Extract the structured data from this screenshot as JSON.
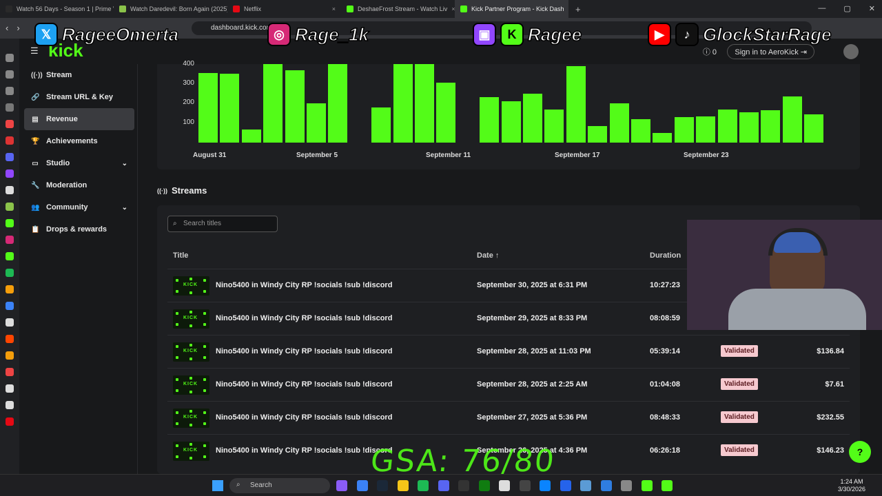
{
  "browser": {
    "tabs": [
      {
        "label": "Watch 56 Days - Season 1 | Prime Vi",
        "color": "#2a2a2a"
      },
      {
        "label": "Watch Daredevil: Born Again (2025) |",
        "color": "#8bc34a"
      },
      {
        "label": "Netflix",
        "color": "#e50914"
      },
      {
        "label": "DeshaeFrost Stream - Watch Liv",
        "color": "#53fc18"
      },
      {
        "label": "Kick Partner Program - Kick Dash",
        "color": "#53fc18"
      }
    ],
    "url": "dashboard.kick.com"
  },
  "overlay": {
    "x_handle": "RageeOmerta",
    "instagram_handle": "Rage_1k",
    "kick_handle": "Ragee",
    "youtube_handle": "GlockStarRage",
    "gsa_text": "GSA: 76/80"
  },
  "header": {
    "signin_label": "Sign in to AeroKick",
    "notif_count": "0"
  },
  "sidebar": {
    "items": [
      {
        "label": "Stream",
        "icon": "((·))"
      },
      {
        "label": "Stream URL & Key",
        "icon": "🔗"
      },
      {
        "label": "Revenue",
        "icon": "▤"
      },
      {
        "label": "Achievements",
        "icon": "🏆"
      },
      {
        "label": "Studio",
        "icon": "▭",
        "chevron": "⌄"
      },
      {
        "label": "Moderation",
        "icon": "🔧"
      },
      {
        "label": "Community",
        "icon": "👥",
        "chevron": "⌄"
      },
      {
        "label": "Drops & rewards",
        "icon": "📋"
      }
    ]
  },
  "chart_data": {
    "type": "bar",
    "y_ticks": [
      "400",
      "300",
      "200",
      "100"
    ],
    "x_ticks": [
      "August 31",
      "September 5",
      "September 11",
      "September 17",
      "September 23"
    ],
    "values": [
      355,
      350,
      65,
      405,
      370,
      200,
      405,
      0,
      180,
      405,
      405,
      305,
      0,
      230,
      210,
      250,
      170,
      390,
      85,
      200,
      120,
      50,
      130,
      135,
      170,
      155,
      165,
      235,
      145
    ],
    "ylim": [
      0,
      420
    ],
    "color": "#53fc18"
  },
  "streams": {
    "heading": "Streams",
    "search_placeholder": "Search titles",
    "columns": {
      "title": "Title",
      "date": "Date",
      "sort_arrow": "↑",
      "duration": "Duration"
    },
    "rows": [
      {
        "title": "Nino5400 in Windy City RP !socials !sub !discord",
        "date": "September 30, 2025 at 6:31 PM",
        "duration": "10:27:23",
        "status": "",
        "amount": ""
      },
      {
        "title": "Nino5400 in Windy City RP !socials !sub !discord",
        "date": "September 29, 2025 at 8:33 PM",
        "duration": "08:08:59",
        "status": "",
        "amount": ""
      },
      {
        "title": "Nino5400 in Windy City RP !socials !sub !discord",
        "date": "September 28, 2025 at 11:03 PM",
        "duration": "05:39:14",
        "status": "Validated",
        "amount": "$136.84"
      },
      {
        "title": "Nino5400 in Windy City RP !socials !sub !discord",
        "date": "September 28, 2025 at 2:25 AM",
        "duration": "01:04:08",
        "status": "Validated",
        "amount": "$7.61"
      },
      {
        "title": "Nino5400 in Windy City RP !socials !sub !discord",
        "date": "September 27, 2025 at 5:36 PM",
        "duration": "08:48:33",
        "status": "Validated",
        "amount": "$232.55"
      },
      {
        "title": "Nino5400 in Windy City RP !socials !sub !discord",
        "date": "September 26, 2025 at 4:36 PM",
        "duration": "06:26:18",
        "status": "Validated",
        "amount": "$146.23"
      }
    ],
    "thumb_text": "KICK"
  },
  "taskbar": {
    "search_label": "Search",
    "time": "1:24 AM",
    "date": "3/30/2026"
  }
}
